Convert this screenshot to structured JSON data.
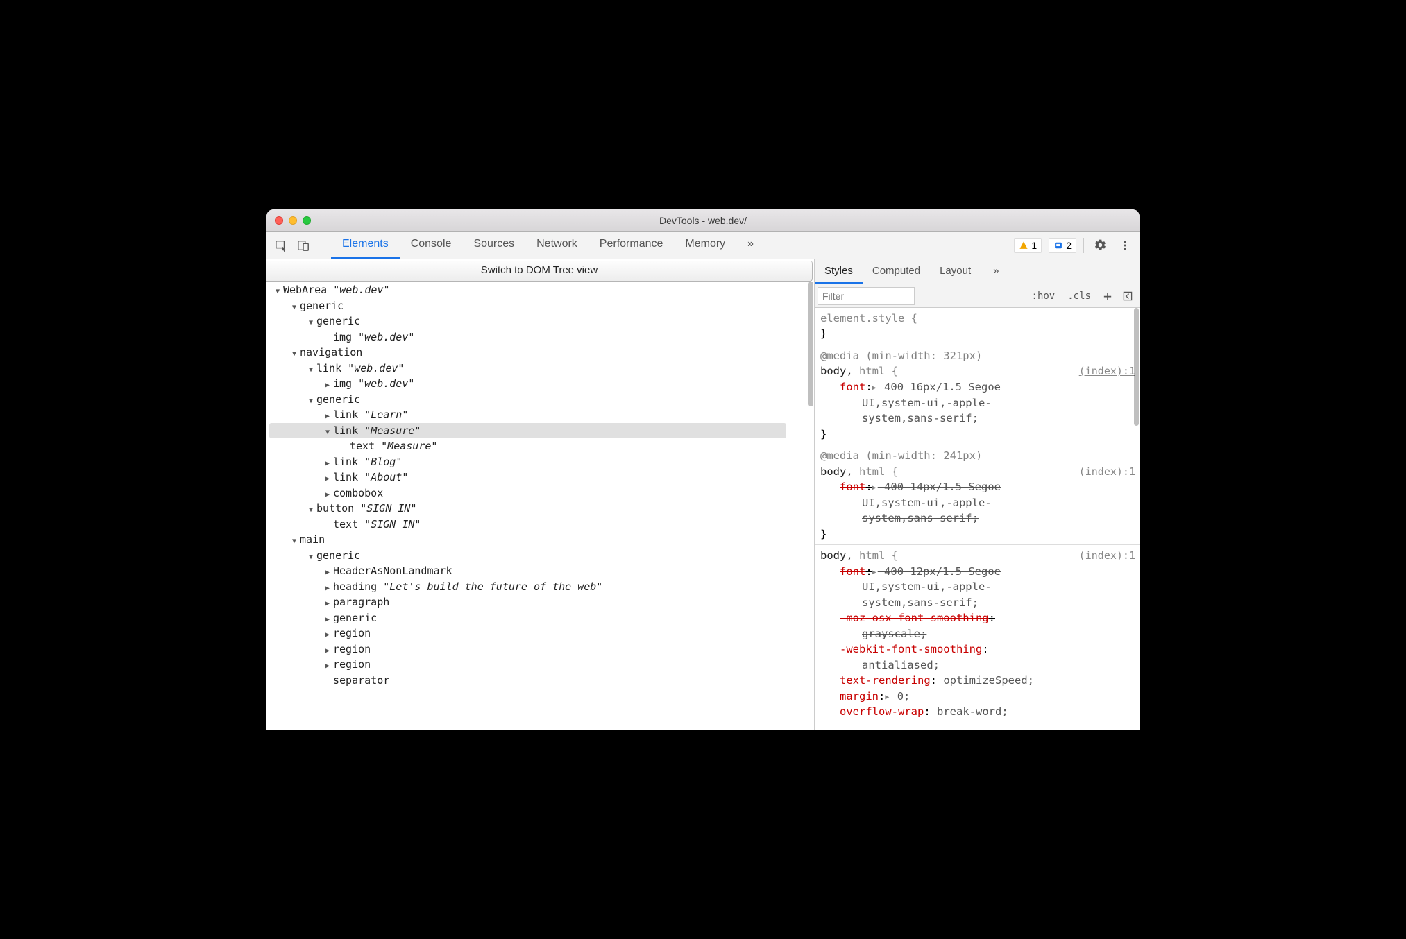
{
  "window": {
    "title": "DevTools - web.dev/"
  },
  "toolbar": {
    "tabs": [
      "Elements",
      "Console",
      "Sources",
      "Network",
      "Performance",
      "Memory"
    ],
    "more": "»",
    "active_tab": 0,
    "counters": {
      "warn": "1",
      "info": "2"
    }
  },
  "dom_switch_label": "Switch to DOM Tree view",
  "ax_tree": [
    {
      "indent": 0,
      "tri": "down",
      "role": "WebArea",
      "name": "web.dev"
    },
    {
      "indent": 1,
      "tri": "down",
      "role": "generic"
    },
    {
      "indent": 2,
      "tri": "down",
      "role": "generic"
    },
    {
      "indent": 3,
      "tri": "",
      "role": "img",
      "name": "web.dev"
    },
    {
      "indent": 1,
      "tri": "down",
      "role": "navigation"
    },
    {
      "indent": 2,
      "tri": "down",
      "role": "link",
      "name": "web.dev"
    },
    {
      "indent": 3,
      "tri": "right",
      "role": "img",
      "name": "web.dev"
    },
    {
      "indent": 2,
      "tri": "down",
      "role": "generic"
    },
    {
      "indent": 3,
      "tri": "right",
      "role": "link",
      "name": "Learn"
    },
    {
      "indent": 3,
      "tri": "down",
      "role": "link",
      "name": "Measure",
      "selected": true
    },
    {
      "indent": 4,
      "tri": "",
      "role": "text",
      "name": "Measure"
    },
    {
      "indent": 3,
      "tri": "right",
      "role": "link",
      "name": "Blog"
    },
    {
      "indent": 3,
      "tri": "right",
      "role": "link",
      "name": "About"
    },
    {
      "indent": 3,
      "tri": "right",
      "role": "combobox"
    },
    {
      "indent": 2,
      "tri": "down",
      "role": "button",
      "name": "SIGN IN"
    },
    {
      "indent": 3,
      "tri": "",
      "role": "text",
      "name": "SIGN IN"
    },
    {
      "indent": 1,
      "tri": "down",
      "role": "main"
    },
    {
      "indent": 2,
      "tri": "down",
      "role": "generic"
    },
    {
      "indent": 3,
      "tri": "right",
      "role": "HeaderAsNonLandmark"
    },
    {
      "indent": 3,
      "tri": "right",
      "role": "heading",
      "name": "Let's build the future of the web"
    },
    {
      "indent": 3,
      "tri": "right",
      "role": "paragraph"
    },
    {
      "indent": 3,
      "tri": "right",
      "role": "generic"
    },
    {
      "indent": 3,
      "tri": "right",
      "role": "region"
    },
    {
      "indent": 3,
      "tri": "right",
      "role": "region"
    },
    {
      "indent": 3,
      "tri": "right",
      "role": "region"
    },
    {
      "indent": 3,
      "tri": "",
      "role": "separator"
    }
  ],
  "right_tabs": {
    "items": [
      "Styles",
      "Computed",
      "Layout"
    ],
    "more": "»",
    "active": 0
  },
  "filter": {
    "placeholder": "Filter",
    "hov": ":hov",
    "cls": ".cls"
  },
  "styles": {
    "element_style_open": "element.style {",
    "close_brace": "}",
    "rules": [
      {
        "media": "@media (min-width: 321px)",
        "selector_primary": "body,",
        "selector_rest": " html",
        "open": " {",
        "source": "(index):1",
        "decls": [
          {
            "prop": "font",
            "expand": true,
            "val_lines": [
              "400 16px/1.5 Segoe",
              "UI,system-ui,-apple-",
              "system,sans-serif;"
            ]
          }
        ]
      },
      {
        "media": "@media (min-width: 241px)",
        "selector_primary": "body,",
        "selector_rest": " html",
        "open": " {",
        "source": "(index):1",
        "decls": [
          {
            "prop": "font",
            "expand": true,
            "struck": true,
            "val_lines": [
              "400 14px/1.5 Segoe",
              "UI,system-ui,-apple-",
              "system,sans-serif;"
            ]
          }
        ]
      },
      {
        "selector_primary": "body,",
        "selector_rest": " html",
        "open": " {",
        "source": "(index):1",
        "decls": [
          {
            "prop": "font",
            "expand": true,
            "struck": true,
            "val_lines": [
              "400 12px/1.5 Segoe",
              "UI,system-ui,-apple-",
              "system,sans-serif;"
            ]
          },
          {
            "prop": "-moz-osx-font-smoothing",
            "struck": true,
            "val_lines": [
              "",
              "grayscale;"
            ]
          },
          {
            "prop": "-webkit-font-smoothing",
            "val_lines": [
              "",
              "antialiased;"
            ]
          },
          {
            "prop": "text-rendering",
            "val_lines": [
              " optimizeSpeed;"
            ]
          },
          {
            "prop": "margin",
            "expand": true,
            "val_lines": [
              " 0;"
            ]
          },
          {
            "prop": "overflow-wrap",
            "struck": true,
            "val_lines": [
              " break-word;"
            ]
          }
        ],
        "no_close": true
      }
    ]
  }
}
